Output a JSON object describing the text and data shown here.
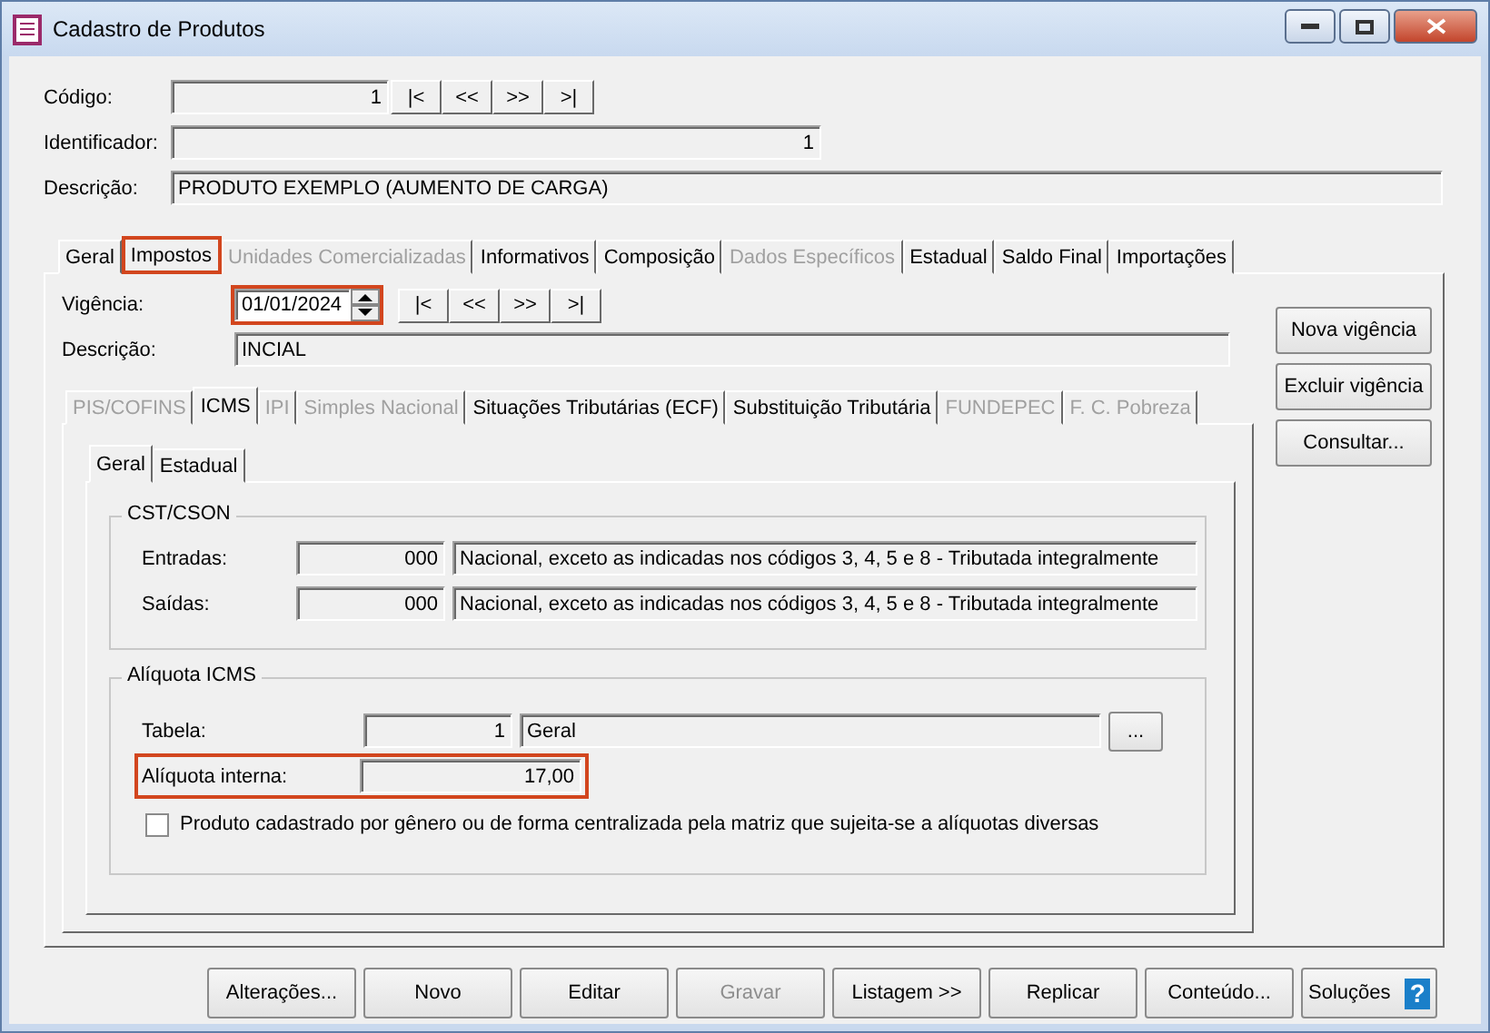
{
  "window": {
    "title": "Cadastro de Produtos"
  },
  "header_fields": [
    {
      "label": "Código:",
      "value": "1",
      "kind": "nav"
    },
    {
      "label": "Identificador:",
      "value": "1",
      "kind": "right"
    },
    {
      "label": "Descrição:",
      "value": "PRODUTO EXEMPLO (AUMENTO DE CARGA)",
      "kind": "left"
    }
  ],
  "nav_buttons": [
    "|<",
    "<<",
    ">>",
    ">|"
  ],
  "main_tabs": [
    {
      "label": "Geral",
      "selected": false,
      "disabled": false,
      "highlighted": false
    },
    {
      "label": "Impostos",
      "selected": true,
      "disabled": false,
      "highlighted": true
    },
    {
      "label": "Unidades Comercializadas",
      "selected": false,
      "disabled": true,
      "highlighted": false
    },
    {
      "label": "Informativos",
      "selected": false,
      "disabled": false,
      "highlighted": false
    },
    {
      "label": "Composição",
      "selected": false,
      "disabled": false,
      "highlighted": false
    },
    {
      "label": "Dados Específicos",
      "selected": false,
      "disabled": true,
      "highlighted": false
    },
    {
      "label": "Estadual",
      "selected": false,
      "disabled": false,
      "highlighted": false
    },
    {
      "label": "Saldo Final",
      "selected": false,
      "disabled": false,
      "highlighted": false
    },
    {
      "label": "Importações",
      "selected": false,
      "disabled": false,
      "highlighted": false
    }
  ],
  "vigencia": {
    "label": "Vigência:",
    "value": "01/01/2024",
    "highlighted": true,
    "nav_buttons": [
      "|<",
      "<<",
      ">>",
      ">|"
    ]
  },
  "vigencia_descricao": {
    "label": "Descrição:",
    "value": "INCIAL"
  },
  "side_buttons": [
    "Nova vigência",
    "Excluir vigência",
    "Consultar..."
  ],
  "sub_tabs": [
    {
      "label": "PIS/COFINS",
      "selected": false,
      "disabled": true
    },
    {
      "label": "ICMS",
      "selected": true,
      "disabled": false
    },
    {
      "label": "IPI",
      "selected": false,
      "disabled": true
    },
    {
      "label": "Simples Nacional",
      "selected": false,
      "disabled": true
    },
    {
      "label": "Situações Tributárias (ECF)",
      "selected": false,
      "disabled": false
    },
    {
      "label": "Substituição Tributária",
      "selected": false,
      "disabled": false
    },
    {
      "label": "FUNDEPEC",
      "selected": false,
      "disabled": true
    },
    {
      "label": "F. C. Pobreza",
      "selected": false,
      "disabled": true
    }
  ],
  "inner_tabs": [
    {
      "label": "Geral",
      "selected": true
    },
    {
      "label": "Estadual",
      "selected": false
    }
  ],
  "cst_group": {
    "title": "CST/CSON",
    "rows": [
      {
        "label": "Entradas:",
        "code": "000",
        "description": "Nacional, exceto as indicadas nos códigos 3, 4, 5 e 8 - Tributada integralmente"
      },
      {
        "label": "Saídas:",
        "code": "000",
        "description": "Nacional, exceto as indicadas nos códigos 3, 4, 5 e 8 - Tributada integralmente"
      }
    ]
  },
  "aliquota_group": {
    "title": "Alíquota ICMS",
    "tabela": {
      "label": "Tabela:",
      "code": "1",
      "description": "Geral",
      "button": "..."
    },
    "interna": {
      "label": "Alíquota interna:",
      "value": "17,00",
      "highlighted": true
    },
    "checkbox": {
      "label": "Produto cadastrado por gênero ou de forma centralizada pela matriz que sujeita-se a alíquotas diversas",
      "checked": false
    }
  },
  "footer_buttons": [
    {
      "label": "Alterações...",
      "disabled": false
    },
    {
      "label": "Novo",
      "disabled": false
    },
    {
      "label": "Editar",
      "disabled": false
    },
    {
      "label": "Gravar",
      "disabled": true
    },
    {
      "label": "Listagem >>",
      "disabled": false
    },
    {
      "label": "Replicar",
      "disabled": false
    },
    {
      "label": "Conteúdo...",
      "disabled": false
    }
  ],
  "help_button": {
    "label": "Soluções",
    "icon_text": "?"
  }
}
